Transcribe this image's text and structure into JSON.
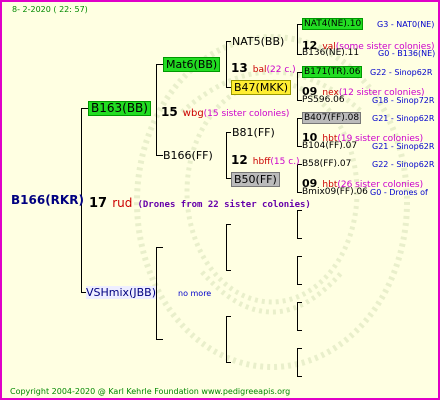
{
  "date": "8-  2-2020 ( 22: 57)",
  "copyright": "Copyright 2004-2020 @ Karl Kehrle Foundation   www.pedigreeapis.org",
  "root": {
    "name": "B166(RKR)",
    "number": "17",
    "code": "rud",
    "desc": "(Drones from 22 sister colonies)"
  },
  "gen1": {
    "top_name": "B163(BB)",
    "top_number": "15",
    "top_code": "wbg",
    "top_desc": "(15 sister colonies)",
    "bottom_name": "VSHmix(JBB)",
    "bottom_note": "no more"
  },
  "gen2": {
    "a_name": "Mat6(BB)",
    "a_number": "13",
    "a_code": "bal",
    "a_desc": "(22 c.)",
    "b_name": "B166(FF)",
    "b_number": "12",
    "b_code": "hbff",
    "b_desc": "(15 c.)"
  },
  "gen3": {
    "a_name": "NAT5(BB)",
    "a_number": "12",
    "a_code": "val",
    "a_desc": "(some sister colonies)",
    "b_name": "B47(MKK)",
    "b_number": "09",
    "b_code": "nex",
    "b_desc": "(12 sister colonies)",
    "c_name": "B81(FF)",
    "c_number": "10",
    "c_code": "hbt",
    "c_desc": "(19 sister colonies)",
    "d_name": "B50(FF)",
    "d_number": "09",
    "d_code": "hbt",
    "d_desc": "(26 sister colonies)"
  },
  "gen4": [
    {
      "name": "NAT4(NE).10",
      "tail": "G3 - NAT0(NE)"
    },
    {
      "name": "B136(NE).11",
      "tail": "G0 - B136(NE)"
    },
    {
      "name": "B171(TR).06",
      "tail": "G22 - Sinop62R"
    },
    {
      "name": "PS596.06",
      "tail": "G18 - Sinop72R"
    },
    {
      "name": "B407(FF).08",
      "tail": "G21 - Sinop62R"
    },
    {
      "name": "B104(FF).07",
      "tail": "G21 - Sinop62R"
    },
    {
      "name": "B58(FF).07",
      "tail": "G22 - Sinop62R"
    },
    {
      "name": "Bmix09(FF).06",
      "tail": "G0 - Drones of"
    }
  ],
  "colors": {
    "frame_border": "#e000c8",
    "background": "#ffffe2",
    "highlight_green": "#22dd22",
    "highlight_yellow": "#ffee33",
    "highlight_gray": "#bbbbbb",
    "code_red": "#cc0000",
    "tail_blue": "#0000cc"
  }
}
